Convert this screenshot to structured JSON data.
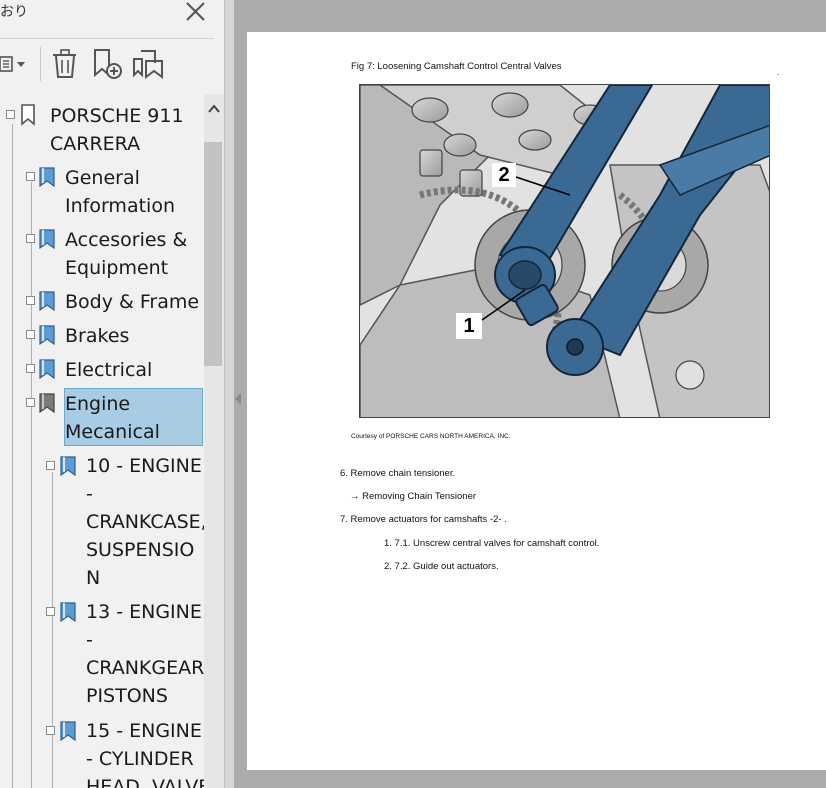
{
  "panel": {
    "title": "おり"
  },
  "tree": {
    "items": [
      {
        "label_lines": [
          "PORSCHE 911",
          "CARRERA"
        ]
      },
      {
        "label_lines": [
          "General",
          "Information"
        ]
      },
      {
        "label_lines": [
          "Accesories &",
          "Equipment"
        ]
      },
      {
        "label_lines": [
          "Body & Frame"
        ]
      },
      {
        "label_lines": [
          "Brakes"
        ]
      },
      {
        "label_lines": [
          "Electrical"
        ]
      },
      {
        "label_lines": [
          "Engine",
          "Mecanical"
        ],
        "selected": true
      },
      {
        "label_lines": [
          "10 - ENGINE",
          "-",
          "CRANKCASE,",
          "SUSPENSIO",
          "N"
        ]
      },
      {
        "label_lines": [
          "13 - ENGINE",
          "-",
          "CRANKGEAR,",
          "PISTONS"
        ]
      },
      {
        "label_lines": [
          "15 - ENGINE",
          "- CYLINDER",
          "HEAD, VALVE"
        ]
      }
    ]
  },
  "document": {
    "fig_caption": "Fig 7: Loosening Camshaft Control Central Valves",
    "corner_mark": ".",
    "callout_1": "1",
    "callout_2": "2",
    "courtesy": "Courtesy of PORSCHE CARS NORTH AMERICA, INC.",
    "step_6": "6. Remove chain tensioner.",
    "step_6_link": "→ Removing Chain Tensioner",
    "step_7": "7. Remove actuators for camshafts -2-  .",
    "step_7_1": "1. 7.1. Unscrew central valves for camshaft control.",
    "step_7_2": "2. 7.2. Guide out actuators."
  },
  "colors": {
    "sidebar_bg": "#f1f1f1",
    "selection_bg": "#a8cce3",
    "viewer_bg": "#ababab",
    "bookmark_blue": "#5c9bd5",
    "wrench_blue": "#3a6a94"
  },
  "icons": [
    "close-icon",
    "options-menu-icon",
    "delete-bookmark-icon",
    "new-bookmark-icon",
    "bookmark-from-selection-icon",
    "bookmark-icon",
    "chevron-up-icon"
  ]
}
